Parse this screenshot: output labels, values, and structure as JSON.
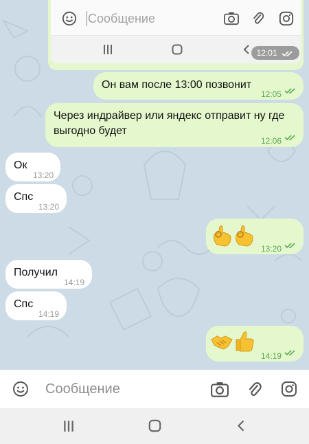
{
  "embedded_screenshot": {
    "placeholder": "Сообщение",
    "time": "12:01"
  },
  "messages": [
    {
      "text": "Он вам после 13:00 позвонит",
      "time": "12:05"
    },
    {
      "text_line1": "Через индрайвер или яндекс отправит ну где",
      "text_line2": "выгодно будет",
      "time": "12:06"
    },
    {
      "text": "Ок",
      "time": "13:20"
    },
    {
      "text": "Спс",
      "time": "13:20"
    },
    {
      "emoji": "ok-hand-ok-hand",
      "time": "13:20"
    },
    {
      "text": "Получил",
      "time": "14:19"
    },
    {
      "text": "Спс",
      "time": "14:19"
    },
    {
      "emoji": "handshake-thumbs-up",
      "time": "14:19"
    }
  ],
  "input": {
    "placeholder": "Сообщение"
  },
  "colors": {
    "outgoing_bubble": "#e5f8cd",
    "incoming_bubble": "#ffffff",
    "chat_background": "#ccdbe5",
    "read_check": "#5eaa55"
  }
}
